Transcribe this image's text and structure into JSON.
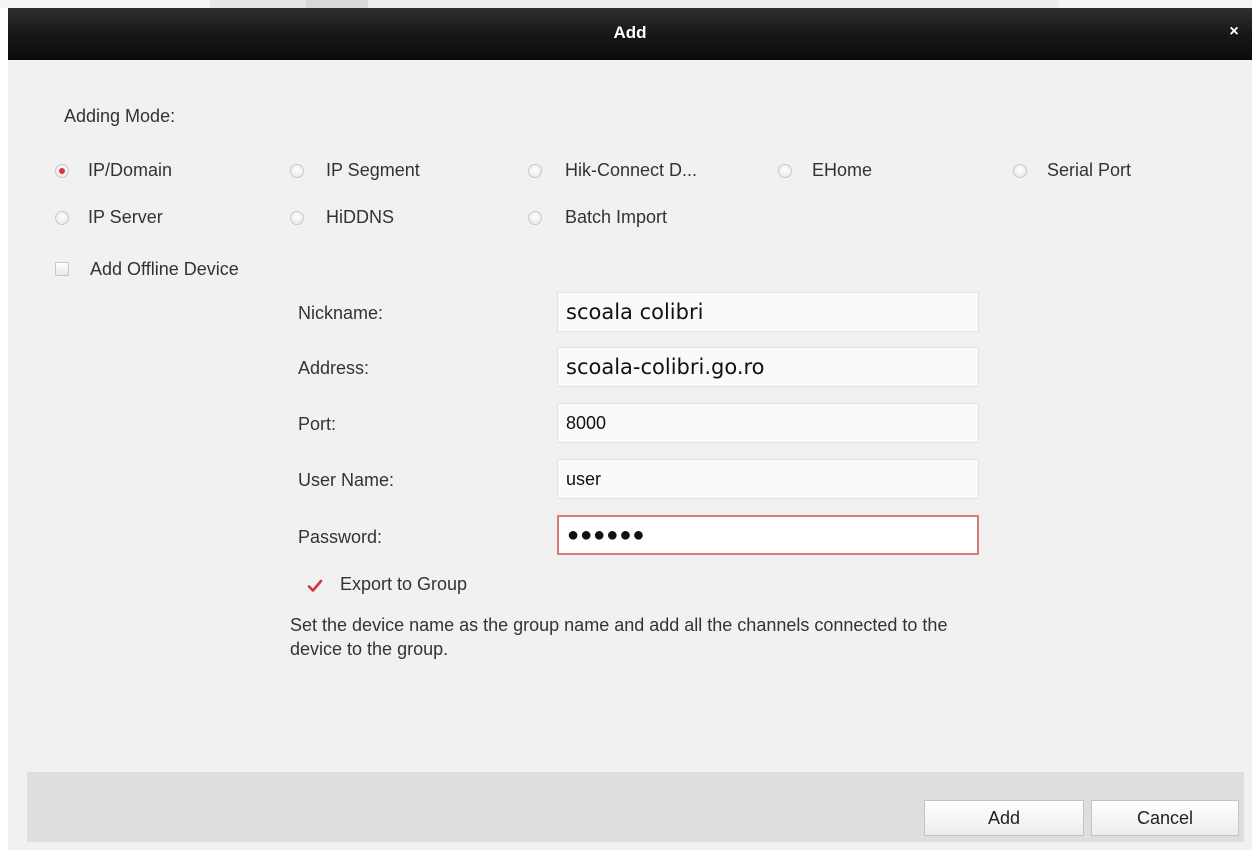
{
  "window": {
    "title": "Add",
    "close_icon": "close-icon"
  },
  "adding_mode": {
    "label": "Adding Mode:",
    "options": [
      {
        "label": "IP/Domain",
        "selected": true
      },
      {
        "label": "IP Segment",
        "selected": false
      },
      {
        "label": "Hik-Connect D...",
        "selected": false
      },
      {
        "label": "EHome",
        "selected": false
      },
      {
        "label": "Serial Port",
        "selected": false
      },
      {
        "label": "IP Server",
        "selected": false
      },
      {
        "label": "HiDDNS",
        "selected": false
      },
      {
        "label": "Batch Import",
        "selected": false
      }
    ]
  },
  "offline_device": {
    "label": "Add Offline Device",
    "checked": false
  },
  "form": {
    "nickname": {
      "label": "Nickname:",
      "value": "scoala colibri"
    },
    "address": {
      "label": "Address:",
      "value": "scoala-colibri.go.ro"
    },
    "port": {
      "label": "Port:",
      "value": "8000"
    },
    "username": {
      "label": "User Name:",
      "value": "user"
    },
    "password": {
      "label": "Password:",
      "value": "●●●●●●"
    }
  },
  "export_group": {
    "label": "Export to Group",
    "checked": true,
    "description": "Set the device name as the group name and add all the channels connected to the device to the group."
  },
  "footer": {
    "add_label": "Add",
    "cancel_label": "Cancel"
  },
  "colors": {
    "accent": "#d8333a",
    "titlebar": "#161616",
    "dialog_bg": "#f1f1f1",
    "footer_bg": "#dedede"
  }
}
